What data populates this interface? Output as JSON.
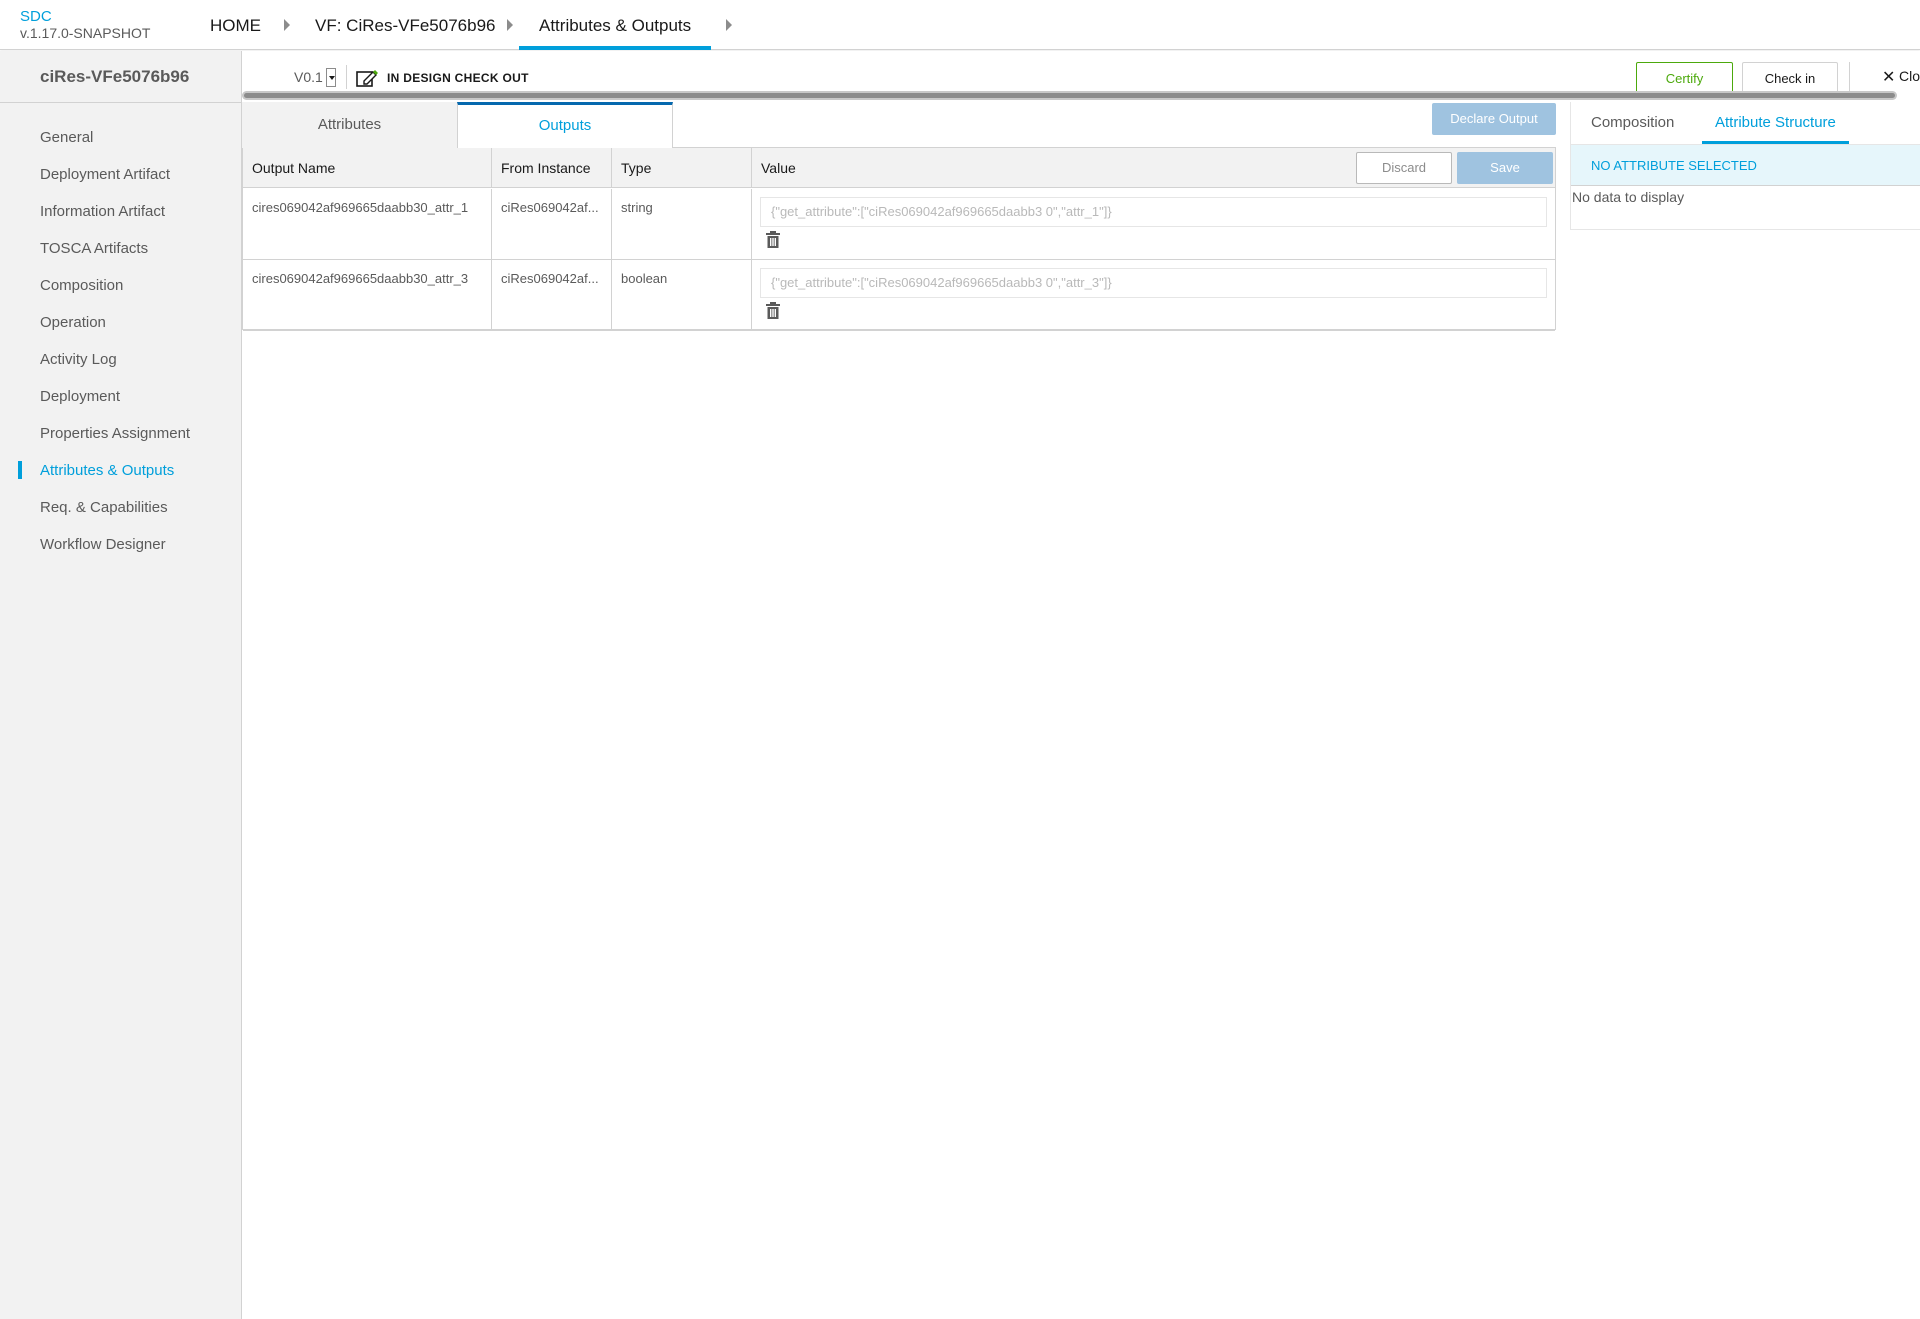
{
  "header": {
    "app_name": "SDC",
    "version": "v.1.17.0-SNAPSHOT",
    "breadcrumbs": [
      "HOME",
      "VF: CiRes-VFe5076b96",
      "Attributes & Outputs"
    ]
  },
  "sidebar": {
    "title": "ciRes-VFe5076b96",
    "items": [
      {
        "label": "General"
      },
      {
        "label": "Deployment Artifact"
      },
      {
        "label": "Information Artifact"
      },
      {
        "label": "TOSCA Artifacts"
      },
      {
        "label": "Composition"
      },
      {
        "label": "Operation"
      },
      {
        "label": "Activity Log"
      },
      {
        "label": "Deployment"
      },
      {
        "label": "Properties Assignment"
      },
      {
        "label": "Attributes & Outputs"
      },
      {
        "label": "Req. & Capabilities"
      },
      {
        "label": "Workflow Designer"
      }
    ],
    "active_item": "Attributes & Outputs"
  },
  "toolbar": {
    "version": "V0.1",
    "status": "IN DESIGN CHECK OUT",
    "certify_label": "Certify",
    "checkin_label": "Check in",
    "close_label": "Clo"
  },
  "main": {
    "tabs": [
      {
        "label": "Attributes"
      },
      {
        "label": "Outputs"
      }
    ],
    "active_tab": "Outputs",
    "declare_output_label": "Declare Output",
    "discard_label": "Discard",
    "save_label": "Save",
    "columns": [
      "Output Name",
      "From Instance",
      "Type",
      "Value"
    ],
    "rows": [
      {
        "name": "cires069042af969665daabb30_attr_1",
        "instance": "ciRes069042af...",
        "type": "string",
        "value": "{\"get_attribute\":[\"ciRes069042af969665daabb3 0\",\"attr_1\"]}"
      },
      {
        "name": "cires069042af969665daabb30_attr_3",
        "instance": "ciRes069042af...",
        "type": "boolean",
        "value": "{\"get_attribute\":[\"ciRes069042af969665daabb3 0\",\"attr_3\"]}"
      }
    ]
  },
  "right_panel": {
    "tabs": [
      {
        "label": "Composition"
      },
      {
        "label": "Attribute Structure"
      }
    ],
    "active_tab": "Attribute Structure",
    "banner": "NO ATTRIBUTE SELECTED",
    "empty_text": "No data to display"
  },
  "colors": {
    "accent": "#009fdb",
    "certify": "#4ca90c",
    "disabled_button": "#9fc3e0",
    "sidebar_bg": "#f2f2f2"
  }
}
